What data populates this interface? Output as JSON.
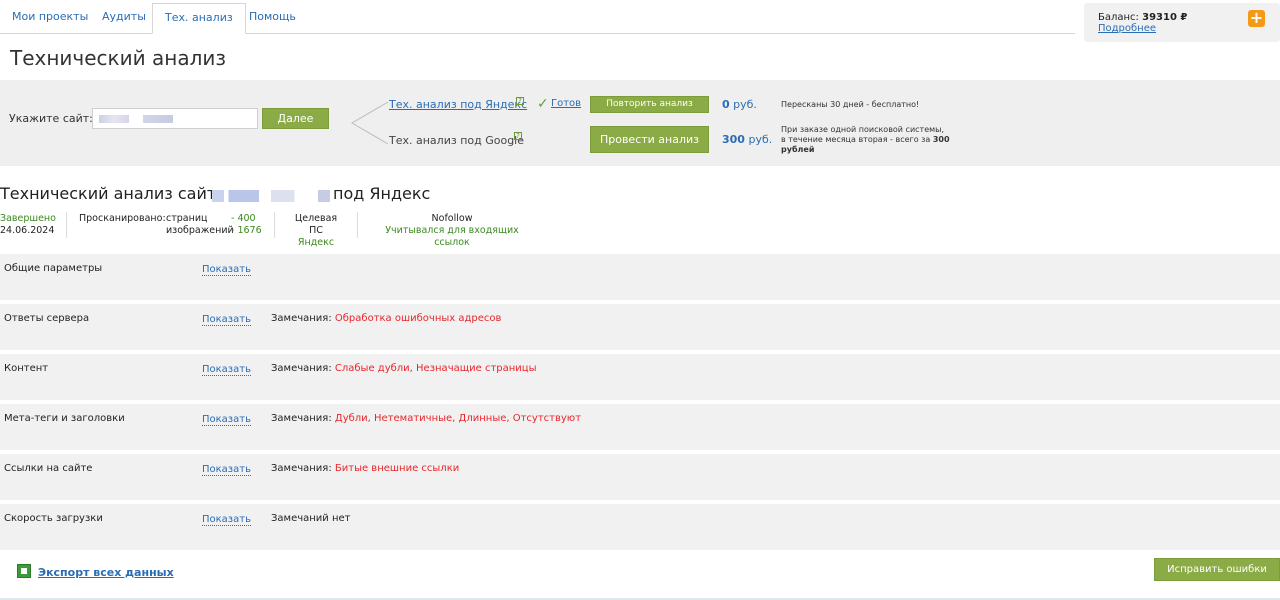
{
  "tabs": [
    {
      "label": "Мои проекты"
    },
    {
      "label": "Аудиты"
    },
    {
      "label": "Тех. анализ"
    },
    {
      "label": "Помощь"
    }
  ],
  "balance": {
    "label": "Баланс:",
    "amount": "39310 ₽",
    "more": "Подробнее",
    "add": "+"
  },
  "page_title": "Технический анализ",
  "panel": {
    "site_label": "Укажите сайт:",
    "go_button": "Далее",
    "yandex_link": "Тех. анализ под Яндекс",
    "google_link": "Тех. анализ под Google",
    "help_mark": "?",
    "check_mark": "✓",
    "ready": "Готов",
    "repeat_button": "Повторить анализ",
    "run_button": "Провести анализ",
    "price_yandex_num": "0",
    "price_yandex_unit": " руб.",
    "price_google_num": "300",
    "price_google_unit": " руб.",
    "note_yandex": "Пересканы 30 дней - бесплатно!",
    "note_google_1": "При заказе одной поисковой системы,",
    "note_google_2": "в течение месяца вторая - всего за ",
    "note_google_bold": "300 рублей"
  },
  "results": {
    "title_prefix": "Технический анализ сайта",
    "title_suffix": "под Яндекс",
    "status": "Завершено",
    "date": "24.06.2024",
    "scanned_label": "Просканировано:",
    "pages_label": "страниц",
    "pages_value": "- 400",
    "images_label": "изображений",
    "images_value": "- 1676",
    "target_label": "Целевая ПС",
    "target_value": "Яндекс",
    "nofollow_label": "Nofollow",
    "nofollow_value": "Учитывался для входящих ссылок"
  },
  "show_label": "Показать",
  "remarks_label": "Замечания:",
  "sections": [
    {
      "name": "Общие параметры",
      "remarks": ""
    },
    {
      "name": "Ответы сервера",
      "remarks": "Обработка ошибочных адресов"
    },
    {
      "name": "Контент",
      "remarks": "Слабые дубли, Незначащие страницы"
    },
    {
      "name": "Мета-теги и заголовки",
      "remarks": "Дубли, Нетематичные, Длинные, Отсутствуют"
    },
    {
      "name": "Ссылки на сайте",
      "remarks": "Битые внешние ссылки"
    },
    {
      "name": "Скорость загрузки",
      "ok": "Замечаний нет"
    }
  ],
  "export_link": "Экспорт всех данных",
  "fix_button": "Исправить ошибки",
  "colors": {
    "accent": "#8bab46",
    "link": "#2a6db5",
    "error": "#e8262b",
    "ok": "#3a8a1e",
    "balance_plus": "#f39a17"
  }
}
